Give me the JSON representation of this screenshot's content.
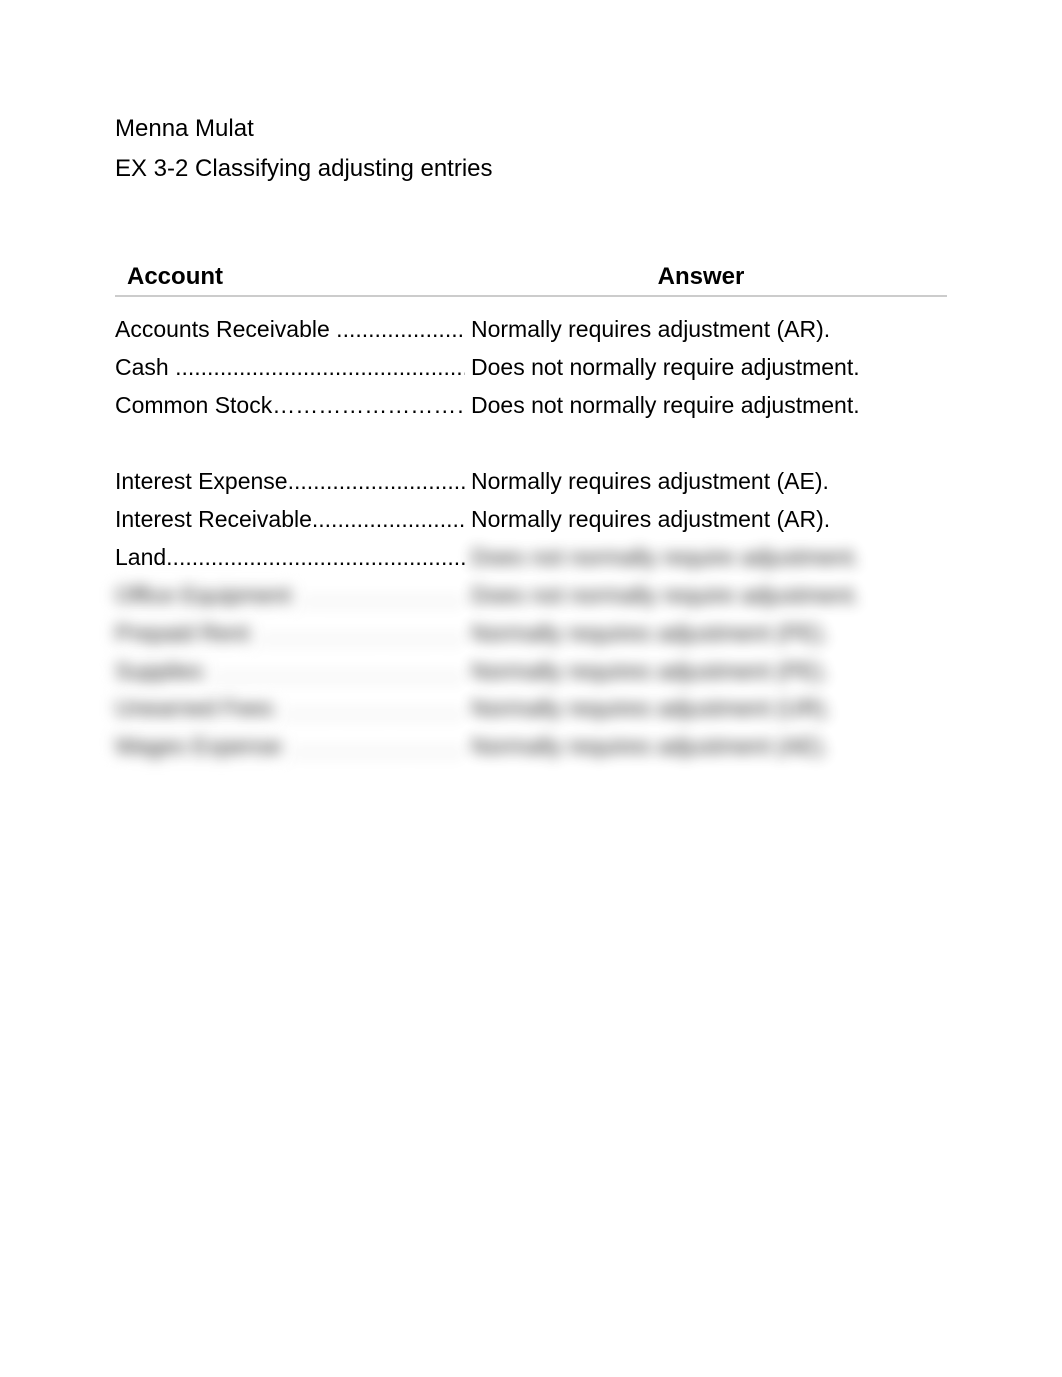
{
  "header": {
    "name": "Menna Mulat",
    "title": "EX 3-2 Classifying adjusting entries"
  },
  "table": {
    "columns": {
      "account": "Account",
      "answer": "Answer"
    },
    "rows": [
      {
        "account": "Accounts Receivable",
        "dots": " .........................",
        "answer": "Normally requires adjustment (AR).",
        "blurred": false
      },
      {
        "account": "Cash",
        "dots": " ................................................",
        "answer": "Does not normally require adjustment.",
        "blurred": false
      },
      {
        "account": "Common Stock",
        "dots": "………………………",
        "answer": "Does not normally require adjustment.",
        "blurred": false
      }
    ],
    "rows2": [
      {
        "account": "Interest Expense",
        "dots": "...............................",
        "answer": "Normally requires adjustment (AE).",
        "blurred": false,
        "answer_blurred": false
      },
      {
        "account": "Interest Receivable",
        "dots": "............................",
        "answer": "Normally requires adjustment (AR).",
        "blurred": false,
        "answer_blurred": false
      },
      {
        "account": "Land",
        "dots": "................................................",
        "answer": "Does not normally require adjustment.",
        "blurred": false,
        "answer_blurred": true
      },
      {
        "account": "Office Equipment",
        "dots": " ...........................",
        "answer": "Does not normally require adjustment.",
        "blurred": true,
        "answer_blurred": true
      },
      {
        "account": "Prepaid Rent",
        "dots": " ..................................",
        "answer": "Normally requires adjustment (PE).",
        "blurred": true,
        "answer_blurred": true
      },
      {
        "account": "Supplies",
        "dots": " .........................................",
        "answer": "Normally requires adjustment (PE).",
        "blurred": true,
        "answer_blurred": true
      },
      {
        "account": "Unearned Fees",
        "dots": " ..............................",
        "answer": "Normally requires adjustment (UR).",
        "blurred": true,
        "answer_blurred": true
      },
      {
        "account": "Wages Expense",
        "dots": " .............................",
        "answer": "Normally requires adjustment (AE).",
        "blurred": true,
        "answer_blurred": true
      }
    ]
  }
}
